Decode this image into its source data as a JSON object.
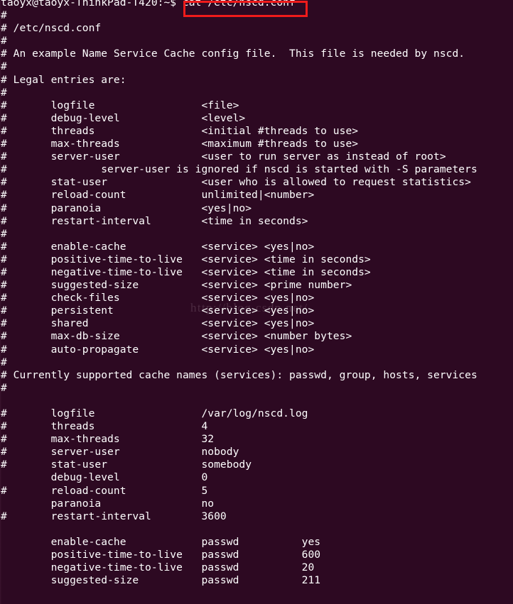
{
  "terminal": {
    "prompt": "taoyx@taoyx-ThinkPad-T420:~$",
    "command": "cat /etc/nscd.conf",
    "highlight_color": "#f01b1b",
    "background_color": "#2d0922",
    "foreground_color": "#ffffff",
    "watermark": "http://blog.csdn.net/",
    "lines": [
      "taoyx@taoyx-ThinkPad-T420:~$ cat /etc/nscd.conf",
      "#",
      "# /etc/nscd.conf",
      "#",
      "# An example Name Service Cache config file.  This file is needed by nscd.",
      "#",
      "# Legal entries are:",
      "#",
      "#       logfile                 <file>",
      "#       debug-level             <level>",
      "#       threads                 <initial #threads to use>",
      "#       max-threads             <maximum #threads to use>",
      "#       server-user             <user to run server as instead of root>",
      "#               server-user is ignored if nscd is started with -S parameters",
      "#       stat-user               <user who is allowed to request statistics>",
      "#       reload-count            unlimited|<number>",
      "#       paranoia                <yes|no>",
      "#       restart-interval        <time in seconds>",
      "#",
      "#       enable-cache            <service> <yes|no>",
      "#       positive-time-to-live   <service> <time in seconds>",
      "#       negative-time-to-live   <service> <time in seconds>",
      "#       suggested-size          <service> <prime number>",
      "#       check-files             <service> <yes|no>",
      "#       persistent              <service> <yes|no>",
      "#       shared                  <service> <yes|no>",
      "#       max-db-size             <service> <number bytes>",
      "#       auto-propagate          <service> <yes|no>",
      "#",
      "# Currently supported cache names (services): passwd, group, hosts, services",
      "#",
      "",
      "#       logfile                 /var/log/nscd.log",
      "#       threads                 4",
      "#       max-threads             32",
      "#       server-user             nobody",
      "#       stat-user               somebody",
      "        debug-level             0",
      "#       reload-count            5",
      "        paranoia                no",
      "#       restart-interval        3600",
      "",
      "        enable-cache            passwd          yes",
      "        positive-time-to-live   passwd          600",
      "        negative-time-to-live   passwd          20",
      "        suggested-size          passwd          211"
    ]
  }
}
